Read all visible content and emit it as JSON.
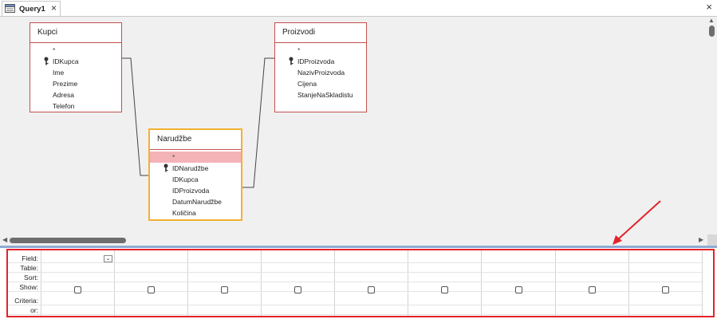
{
  "tab": {
    "label": "Query1",
    "close": "×"
  },
  "window": {
    "close": "×"
  },
  "tables": {
    "kupci": {
      "title": "Kupci",
      "fields": [
        "*",
        "IDKupca",
        "Ime",
        "Prezime",
        "Adresa",
        "Telefon"
      ]
    },
    "proizvodi": {
      "title": "Proizvodi",
      "fields": [
        "*",
        "IDProizvoda",
        "NazivProizvoda",
        "Cijena",
        "StanjeNaSkladistu"
      ]
    },
    "narudzbe": {
      "title": "Narudžbe",
      "fields": [
        "*",
        "IDNarudžbe",
        "IDKupca",
        "IDProizvoda",
        "DatumNarudžbe",
        "Količina"
      ]
    }
  },
  "grid": {
    "row_labels": [
      "Field:",
      "Table:",
      "Sort:",
      "Show:",
      "Criteria:",
      "or:"
    ],
    "column_count": 9
  },
  "colors": {
    "selected_table_border": "#f3b032",
    "table_border": "#c0504d",
    "highlight_row": "#f4b3b7",
    "annotation": "#e3232b"
  }
}
